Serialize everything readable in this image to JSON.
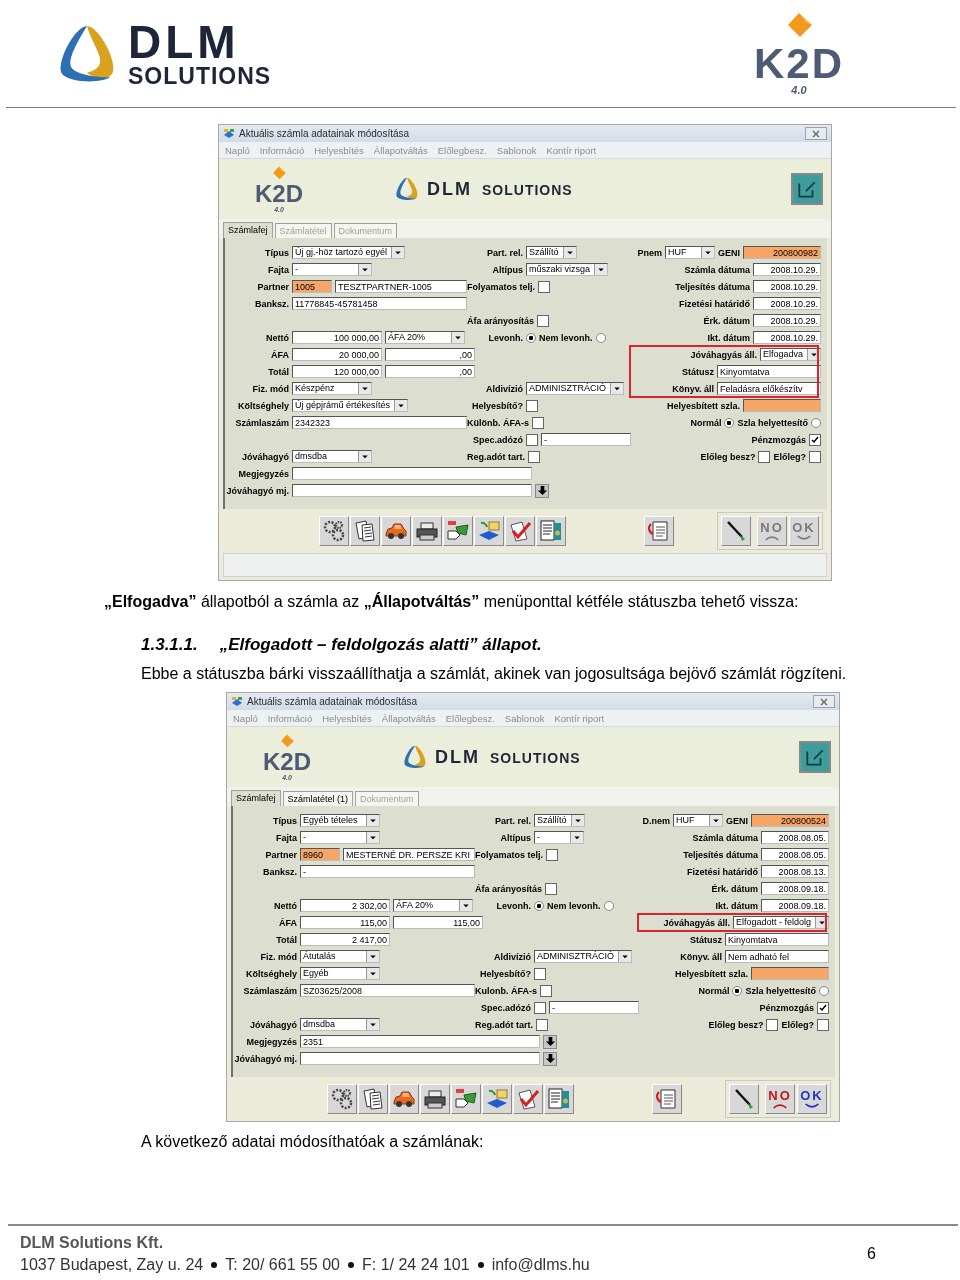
{
  "page_header": {
    "dlm_logo": {
      "name": "DLM",
      "tagline": "SOLUTIONS"
    },
    "k2d_logo": {
      "name": "K2D",
      "version": "4.0"
    }
  },
  "content": [
    {
      "kind": "screenshot",
      "title": "Aktuális számla adatainak módosítása",
      "menu": [
        "Napló",
        "Információ",
        "Helyesbítés",
        "Állapotváltás",
        "Előlegbesz.",
        "Sablonok",
        "Kontír riport"
      ],
      "k2d_logo": {
        "name": "K2D",
        "version": "4.0"
      },
      "dlm_logo": {
        "name": "DLM",
        "tagline": "SOLUTIONS"
      },
      "tabs": [
        {
          "label": "Számlafej",
          "selected": true,
          "disabled": false
        },
        {
          "label": "Számlatétel",
          "selected": false,
          "disabled": true
        },
        {
          "label": "Dokumentum",
          "selected": false,
          "disabled": true
        }
      ],
      "rows": [
        {
          "left": [
            {
              "kind": "label",
              "text": "Típus"
            },
            {
              "kind": "combo",
              "value": "Új gj.-höz tartozó egyél"
            }
          ],
          "mid": [
            {
              "kind": "label",
              "text": "Part. rel."
            },
            {
              "kind": "combo",
              "value": "Szállító"
            }
          ],
          "right": [
            {
              "kind": "label",
              "text": "Pnem"
            },
            {
              "kind": "combo",
              "value": "HUF"
            },
            {
              "kind": "label",
              "text": "GENI"
            },
            {
              "kind": "key",
              "value": "200800982"
            }
          ]
        },
        {
          "left": [
            {
              "kind": "label",
              "text": "Fajta"
            },
            {
              "kind": "combo",
              "value": "-"
            }
          ],
          "mid": [
            {
              "kind": "label",
              "text": "Altípus"
            },
            {
              "kind": "combo",
              "value": "műszaki vizsga"
            }
          ],
          "right": [
            {
              "kind": "label",
              "text": "Számla dátuma"
            },
            {
              "kind": "date",
              "value": "2008.10.29."
            }
          ]
        },
        {
          "left": [
            {
              "kind": "label",
              "text": "Partner"
            },
            {
              "kind": "key",
              "value": "1005"
            },
            {
              "kind": "text",
              "value": "TESZTPARTNER-1005"
            }
          ],
          "mid": [
            {
              "kind": "label",
              "text": "Folyamatos telj."
            },
            {
              "kind": "check",
              "checked": false
            }
          ],
          "right": [
            {
              "kind": "label",
              "text": "Teljesítés dátuma"
            },
            {
              "kind": "date",
              "value": "2008.10.29."
            }
          ]
        },
        {
          "left": [
            {
              "kind": "label",
              "text": "Banksz."
            },
            {
              "kind": "text",
              "value": "11778845-45781458"
            }
          ],
          "right": [
            {
              "kind": "label",
              "text": "Fizetési határidő"
            },
            {
              "kind": "date",
              "value": "2008.10.29."
            }
          ]
        },
        {
          "mid": [
            {
              "kind": "label",
              "text": "Áfa arányosítás"
            },
            {
              "kind": "check",
              "checked": false
            }
          ],
          "right": [
            {
              "kind": "label",
              "text": "Érk. dátum"
            },
            {
              "kind": "date",
              "value": "2008.10.29."
            }
          ]
        },
        {
          "left": [
            {
              "kind": "label",
              "text": "Nettó"
            },
            {
              "kind": "amount",
              "value": "100 000,00"
            },
            {
              "kind": "combo",
              "value": "ÁFA 20%"
            }
          ],
          "mid": [
            {
              "kind": "label",
              "text": "Levonh."
            },
            {
              "kind": "radio",
              "selected": true
            },
            {
              "kind": "label",
              "text": "Nem levonh."
            },
            {
              "kind": "radio",
              "selected": false
            }
          ],
          "right": [
            {
              "kind": "label",
              "text": "Ikt. dátum"
            },
            {
              "kind": "date",
              "value": "2008.10.29."
            }
          ]
        },
        {
          "marked": true,
          "left": [
            {
              "kind": "label",
              "text": "ÁFA"
            },
            {
              "kind": "amount",
              "value": "20 000,00"
            },
            {
              "kind": "amount",
              "value": ",00"
            }
          ],
          "right": [
            {
              "kind": "label",
              "text": "Jóváhagyás áll."
            },
            {
              "kind": "combo",
              "value": "Elfogadva"
            }
          ]
        },
        {
          "marked": true,
          "left": [
            {
              "kind": "label",
              "text": "Totál"
            },
            {
              "kind": "amount",
              "value": "120 000,00"
            },
            {
              "kind": "amount",
              "value": ",00"
            }
          ],
          "right": [
            {
              "kind": "label",
              "text": "Státusz"
            },
            {
              "kind": "text",
              "value": "Kinyomtatva"
            }
          ]
        },
        {
          "marked": true,
          "left": [
            {
              "kind": "label",
              "text": "Fiz. mód"
            },
            {
              "kind": "combo",
              "value": "Készpénz"
            }
          ],
          "mid": [
            {
              "kind": "label",
              "text": "Aldivízió"
            },
            {
              "kind": "combo",
              "value": "ADMINISZTRÁCIÓ"
            }
          ],
          "right": [
            {
              "kind": "label",
              "text": "Könyv. áll"
            },
            {
              "kind": "text",
              "value": "Feladásra előkészítv"
            }
          ]
        },
        {
          "left": [
            {
              "kind": "label",
              "text": "Költséghely"
            },
            {
              "kind": "combo",
              "value": "Új gépjrámű értékesítés"
            }
          ],
          "mid": [
            {
              "kind": "label",
              "text": "Helyesbítő?"
            },
            {
              "kind": "check",
              "checked": false
            }
          ],
          "right": [
            {
              "kind": "label",
              "text": "Helyesbített szla."
            },
            {
              "kind": "key"
            }
          ]
        },
        {
          "left": [
            {
              "kind": "label",
              "text": "Számlaszám"
            },
            {
              "kind": "text",
              "value": "2342323"
            }
          ],
          "mid": [
            {
              "kind": "label",
              "text": "Különb. ÁFA-s"
            },
            {
              "kind": "check",
              "checked": false
            }
          ],
          "right": [
            {
              "kind": "label",
              "text": "Normál"
            },
            {
              "kind": "radio",
              "selected": true
            },
            {
              "kind": "label",
              "text": "Szla helyettesítő"
            },
            {
              "kind": "radio",
              "selected": false
            }
          ]
        },
        {
          "mid": [
            {
              "kind": "label",
              "text": "Spec.adózó"
            },
            {
              "kind": "check",
              "checked": false
            },
            {
              "kind": "text",
              "value": "-"
            }
          ],
          "right": [
            {
              "kind": "label",
              "text": "Pénzmozgás"
            },
            {
              "kind": "check",
              "checked": true
            }
          ]
        },
        {
          "left": [
            {
              "kind": "label",
              "text": "Jóváhagyó"
            },
            {
              "kind": "combo",
              "value": "dmsdba"
            }
          ],
          "mid": [
            {
              "kind": "label",
              "text": "Reg.adót tart."
            },
            {
              "kind": "check",
              "checked": false
            }
          ],
          "right": [
            {
              "kind": "label",
              "text": "Előleg besz?"
            },
            {
              "kind": "check",
              "checked": false
            },
            {
              "kind": "label",
              "text": "Előleg?"
            },
            {
              "kind": "check",
              "checked": false
            }
          ]
        },
        {
          "left": [
            {
              "kind": "label",
              "text": "Megjegyzés"
            },
            {
              "kind": "memo"
            }
          ]
        },
        {
          "left": [
            {
              "kind": "label",
              "text": "Jóváhagyó mj."
            },
            {
              "kind": "memo"
            },
            {
              "kind": "arrow"
            }
          ]
        }
      ],
      "no_button": {
        "label": "NO",
        "disabled": true
      },
      "ok_button": {
        "label": "OK",
        "disabled": true
      },
      "status_bar": true
    },
    {
      "kind": "intro",
      "text": "**„Elfogadva”** állapotból a számla az **„Állapotváltás”** menüponttal kétféle státuszba tehető vissza:"
    },
    {
      "kind": "heading",
      "number": "1.3.1.1.",
      "text": "„Elfogadott – feldolgozás alatti” állapot."
    },
    {
      "kind": "paragraph",
      "text": "Ebbe a státuszba bárki visszaállíthatja a számlát, akinek van jogosultsága bejövő számlát rögzíteni."
    },
    {
      "kind": "screenshot",
      "title": "Aktuális számla adatainak módosítása",
      "menu": [
        "Napló",
        "Információ",
        "Helyesbítés",
        "Állapotváltás",
        "Előlegbesz.",
        "Sablonok",
        "Kontír riport"
      ],
      "k2d_logo": {
        "name": "K2D",
        "version": "4.0"
      },
      "dlm_logo": {
        "name": "DLM",
        "tagline": "SOLUTIONS"
      },
      "tabs": [
        {
          "label": "Számlafej",
          "selected": true,
          "disabled": false
        },
        {
          "label": "Számlatétel (1)",
          "selected": false,
          "disabled": false
        },
        {
          "label": "Dokumentum",
          "selected": false,
          "disabled": true
        }
      ],
      "rows": [
        {
          "left": [
            {
              "kind": "label",
              "text": "Típus"
            },
            {
              "kind": "combo",
              "value": "Egyéb tételes"
            }
          ],
          "mid": [
            {
              "kind": "label",
              "text": "Part. rel."
            },
            {
              "kind": "combo",
              "value": "Szállító"
            }
          ],
          "right": [
            {
              "kind": "label",
              "text": "D.nem"
            },
            {
              "kind": "combo",
              "value": "HUF"
            },
            {
              "kind": "label",
              "text": "GENI"
            },
            {
              "kind": "key",
              "value": "200800524"
            }
          ]
        },
        {
          "left": [
            {
              "kind": "label",
              "text": "Fajta"
            },
            {
              "kind": "combo",
              "value": "-"
            }
          ],
          "mid": [
            {
              "kind": "label",
              "text": "Altípus"
            },
            {
              "kind": "combo",
              "value": "-"
            }
          ],
          "right": [
            {
              "kind": "label",
              "text": "Számla dátuma"
            },
            {
              "kind": "date",
              "value": "2008.08.05."
            }
          ]
        },
        {
          "left": [
            {
              "kind": "label",
              "text": "Partner"
            },
            {
              "kind": "key",
              "value": "8960"
            },
            {
              "kind": "text",
              "value": "MESTERNÉ DR. PERSZE KRI"
            }
          ],
          "mid": [
            {
              "kind": "label",
              "text": "Folyamatos telj."
            },
            {
              "kind": "check",
              "checked": false
            }
          ],
          "right": [
            {
              "kind": "label",
              "text": "Teljesítés dátuma"
            },
            {
              "kind": "date",
              "value": "2008.08.05."
            }
          ]
        },
        {
          "left": [
            {
              "kind": "label",
              "text": "Banksz."
            },
            {
              "kind": "text",
              "value": "-"
            }
          ],
          "right": [
            {
              "kind": "label",
              "text": "Fizetési határidő"
            },
            {
              "kind": "date",
              "value": "2008.08.13."
            }
          ]
        },
        {
          "mid": [
            {
              "kind": "label",
              "text": "Áfa arányosítás"
            },
            {
              "kind": "check",
              "checked": false
            }
          ],
          "right": [
            {
              "kind": "label",
              "text": "Érk. dátum"
            },
            {
              "kind": "date",
              "value": "2008.09.18."
            }
          ]
        },
        {
          "left": [
            {
              "kind": "label",
              "text": "Nettó"
            },
            {
              "kind": "amount",
              "value": "2 302,00"
            },
            {
              "kind": "combo",
              "value": "ÁFA 20%"
            }
          ],
          "mid": [
            {
              "kind": "label",
              "text": "Levonh."
            },
            {
              "kind": "radio",
              "selected": true
            },
            {
              "kind": "label",
              "text": "Nem levonh."
            },
            {
              "kind": "radio",
              "selected": false
            }
          ],
          "right": [
            {
              "kind": "label",
              "text": "Ikt. dátum"
            },
            {
              "kind": "date",
              "value": "2008.09.18."
            }
          ]
        },
        {
          "marked": true,
          "left": [
            {
              "kind": "label",
              "text": "ÁFA"
            },
            {
              "kind": "amount",
              "value": "115,00"
            },
            {
              "kind": "amount",
              "value": "115,00"
            }
          ],
          "right": [
            {
              "kind": "label",
              "text": "Jóváhagyás áll."
            },
            {
              "kind": "combo",
              "value": "Elfogadott - feldolg"
            }
          ]
        },
        {
          "left": [
            {
              "kind": "label",
              "text": "Totál"
            },
            {
              "kind": "amount",
              "value": "2 417,00"
            }
          ],
          "right": [
            {
              "kind": "label",
              "text": "Státusz"
            },
            {
              "kind": "text",
              "value": "Kinyomtatva"
            }
          ]
        },
        {
          "left": [
            {
              "kind": "label",
              "text": "Fiz. mód"
            },
            {
              "kind": "combo",
              "value": "Átutalás"
            }
          ],
          "mid": [
            {
              "kind": "label",
              "text": "Aldivízió"
            },
            {
              "kind": "combo",
              "value": "ADMINISZTRÁCIÓ"
            }
          ],
          "right": [
            {
              "kind": "label",
              "text": "Könyv. áll"
            },
            {
              "kind": "text",
              "value": "Nem adható fel"
            }
          ]
        },
        {
          "left": [
            {
              "kind": "label",
              "text": "Költséghely"
            },
            {
              "kind": "combo",
              "value": "Egyéb"
            }
          ],
          "mid": [
            {
              "kind": "label",
              "text": "Helyesbítő?"
            },
            {
              "kind": "check",
              "checked": false
            }
          ],
          "right": [
            {
              "kind": "label",
              "text": "Helyesbített szla."
            },
            {
              "kind": "key"
            }
          ]
        },
        {
          "left": [
            {
              "kind": "label",
              "text": "Számlaszám"
            },
            {
              "kind": "text",
              "value": "SZ03625/2008"
            }
          ],
          "mid": [
            {
              "kind": "label",
              "text": "Kulonb. ÁFA-s"
            },
            {
              "kind": "check",
              "checked": false
            }
          ],
          "right": [
            {
              "kind": "label",
              "text": "Normál"
            },
            {
              "kind": "radio",
              "selected": true
            },
            {
              "kind": "label",
              "text": "Szla helyettesítő"
            },
            {
              "kind": "radio",
              "selected": false
            }
          ]
        },
        {
          "mid": [
            {
              "kind": "label",
              "text": "Spec.adózó"
            },
            {
              "kind": "check",
              "checked": false
            },
            {
              "kind": "text",
              "value": "-"
            }
          ],
          "right": [
            {
              "kind": "label",
              "text": "Pénzmozgás"
            },
            {
              "kind": "check",
              "checked": true
            }
          ]
        },
        {
          "left": [
            {
              "kind": "label",
              "text": "Jóváhagyó"
            },
            {
              "kind": "combo",
              "value": "dmsdba"
            }
          ],
          "mid": [
            {
              "kind": "label",
              "text": "Reg.adót tart."
            },
            {
              "kind": "check",
              "checked": false
            }
          ],
          "right": [
            {
              "kind": "label",
              "text": "Előleg besz?"
            },
            {
              "kind": "check",
              "checked": false
            },
            {
              "kind": "label",
              "text": "Előleg?"
            },
            {
              "kind": "check",
              "checked": false
            }
          ]
        },
        {
          "left": [
            {
              "kind": "label",
              "text": "Megjegyzés"
            },
            {
              "kind": "memo",
              "value": "2351"
            },
            {
              "kind": "arrow"
            }
          ]
        },
        {
          "left": [
            {
              "kind": "label",
              "text": "Jóváhagyó mj."
            },
            {
              "kind": "memo"
            },
            {
              "kind": "arrow"
            }
          ]
        }
      ],
      "no_button": {
        "label": "NO",
        "disabled": false
      },
      "ok_button": {
        "label": "OK",
        "disabled": false
      }
    },
    {
      "kind": "paragraph",
      "text": "A következő adatai módosíthatóak a számlának:"
    }
  ],
  "footer": {
    "company": "DLM Solutions Kft.",
    "contacts": [
      "1037 Budapest, Zay u. 24",
      "T: 20/ 661 55 00",
      "F: 1/ 24 24 101",
      "info@dlms.hu"
    ],
    "page_number": "6"
  }
}
